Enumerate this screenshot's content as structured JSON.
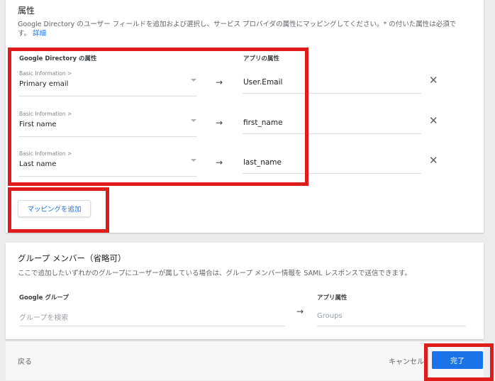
{
  "attributes": {
    "title": "属性",
    "description": "Google Directory のユーザー フィールドを追加および選択し、サービス プロバイダの属性にマッピングしてください。* の付いた属性は必須で",
    "description_line2": "す。",
    "details_link": "詳細",
    "col_source": "Google Directory の属性",
    "col_target": "アプリの属性",
    "rows": [
      {
        "category": "Basic Information >",
        "source": "Primary email",
        "target": "User.Email"
      },
      {
        "category": "Basic Information >",
        "source": "First name",
        "target": "first_name"
      },
      {
        "category": "Basic Information >",
        "source": "Last name",
        "target": "last_name"
      }
    ],
    "arrow": "→",
    "remove": "✕",
    "add_button": "マッピングを追加"
  },
  "groups": {
    "title": "グループ メンバー（省略可）",
    "description": "ここで追加したいずれかのグループにユーザーが属している場合は、グループ メンバー情報を SAML レスポンスで送信できます。",
    "col_source": "Google グループ",
    "col_target": "アプリ属性",
    "search_placeholder": "グループを検索",
    "arrow": "→",
    "target_placeholder": "Groups"
  },
  "footer": {
    "back": "戻る",
    "cancel": "キャンセル",
    "done": "完了"
  },
  "colors": {
    "accent": "#1a73e8",
    "highlight": "#e01b1b"
  }
}
